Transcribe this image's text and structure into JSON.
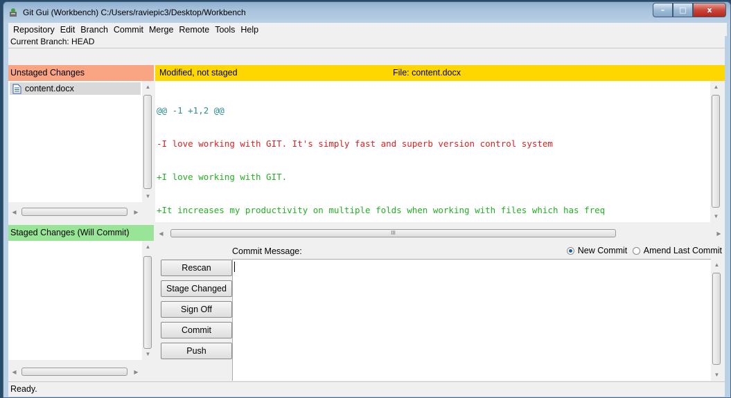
{
  "window": {
    "title": "Git Gui (Workbench) C:/Users/raviepic3/Desktop/Workbench",
    "minimize": "–",
    "maximize": "□",
    "close": "x"
  },
  "menu": [
    "Repository",
    "Edit",
    "Branch",
    "Commit",
    "Merge",
    "Remote",
    "Tools",
    "Help"
  ],
  "branch_line": "Current Branch: HEAD",
  "unstaged": {
    "header": "Unstaged Changes",
    "files": [
      {
        "name": "content.docx",
        "icon": "document-icon"
      }
    ]
  },
  "staged": {
    "header": "Staged Changes (Will Commit)",
    "files": []
  },
  "diff": {
    "status": "Modified, not staged",
    "file_label": "File:  content.docx",
    "lines": [
      {
        "text": "@@ -1 +1,2 @@",
        "kind": "hunk"
      },
      {
        "text": "-I love working with GIT. It's simply fast and superb version control system",
        "kind": "del"
      },
      {
        "text": "+I love working with GIT.",
        "kind": "add"
      },
      {
        "text": "+It increases my productivity on multiple folds when working with files which has freq",
        "kind": "add"
      }
    ],
    "hscroll_grip": "III"
  },
  "commit": {
    "label": "Commit Message:",
    "new_commit": "New Commit",
    "amend": "Amend Last Commit",
    "mode": "new",
    "message": "",
    "buttons": {
      "rescan": "Rescan",
      "stage_changed": "Stage Changed",
      "sign_off": "Sign Off",
      "commit": "Commit",
      "push": "Push"
    }
  },
  "status": "Ready.",
  "colors": {
    "unstaged_header": "#f9a584",
    "staged_header": "#98e598",
    "diff_header": "#ffd700",
    "hunk": "#2e8b8b",
    "del": "#e02020",
    "add": "#22b022"
  }
}
